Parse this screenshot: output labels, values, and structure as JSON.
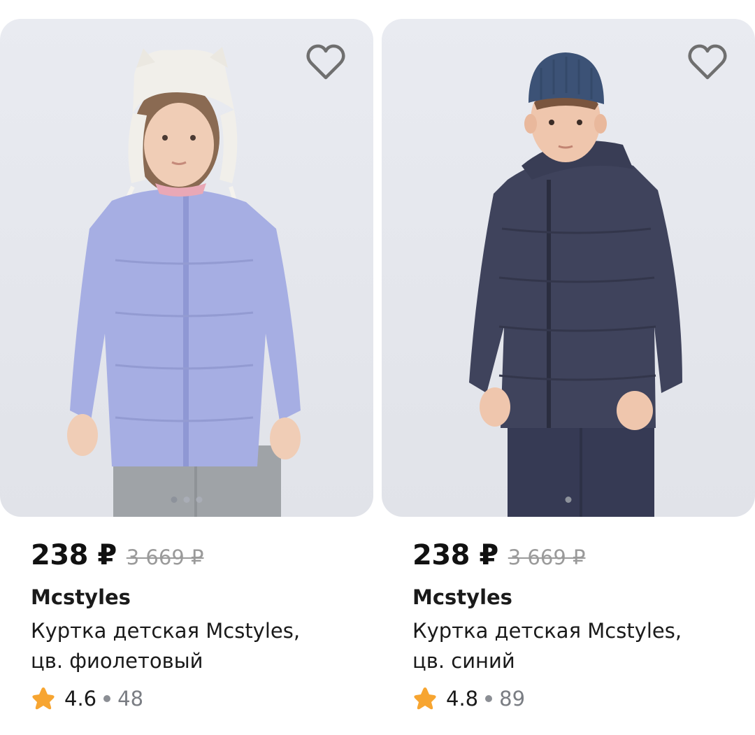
{
  "products": [
    {
      "price": "238 ₽",
      "old_price": "3 669 ₽",
      "brand": "Mcstyles",
      "title_line1": "Куртка детская Mcstyles,",
      "title_line2": "цв. фиолетовый",
      "rating": "4.6",
      "reviews": "48",
      "image_dots": 3,
      "active_dot": 1,
      "favorite_icon": "heart-outline-icon",
      "jacket_color": "#a6aee3",
      "pants_color": "#9fa3a7",
      "hat_color": "#f1efea"
    },
    {
      "price": "238 ₽",
      "old_price": "3 669 ₽",
      "brand": "Mcstyles",
      "title_line1": "Куртка детская Mcstyles,",
      "title_line2": "цв. синий",
      "rating": "4.8",
      "reviews": "89",
      "image_dots": 1,
      "active_dot": 1,
      "favorite_icon": "heart-outline-icon",
      "jacket_color": "#3f435c",
      "pants_color": "#363a54",
      "hat_color": "#3c5276"
    }
  ],
  "colors": {
    "star": "#f7a531",
    "card_bg": "#e7e9ef",
    "old_price": "#9a9a9a",
    "reviews": "#7a7d83"
  }
}
